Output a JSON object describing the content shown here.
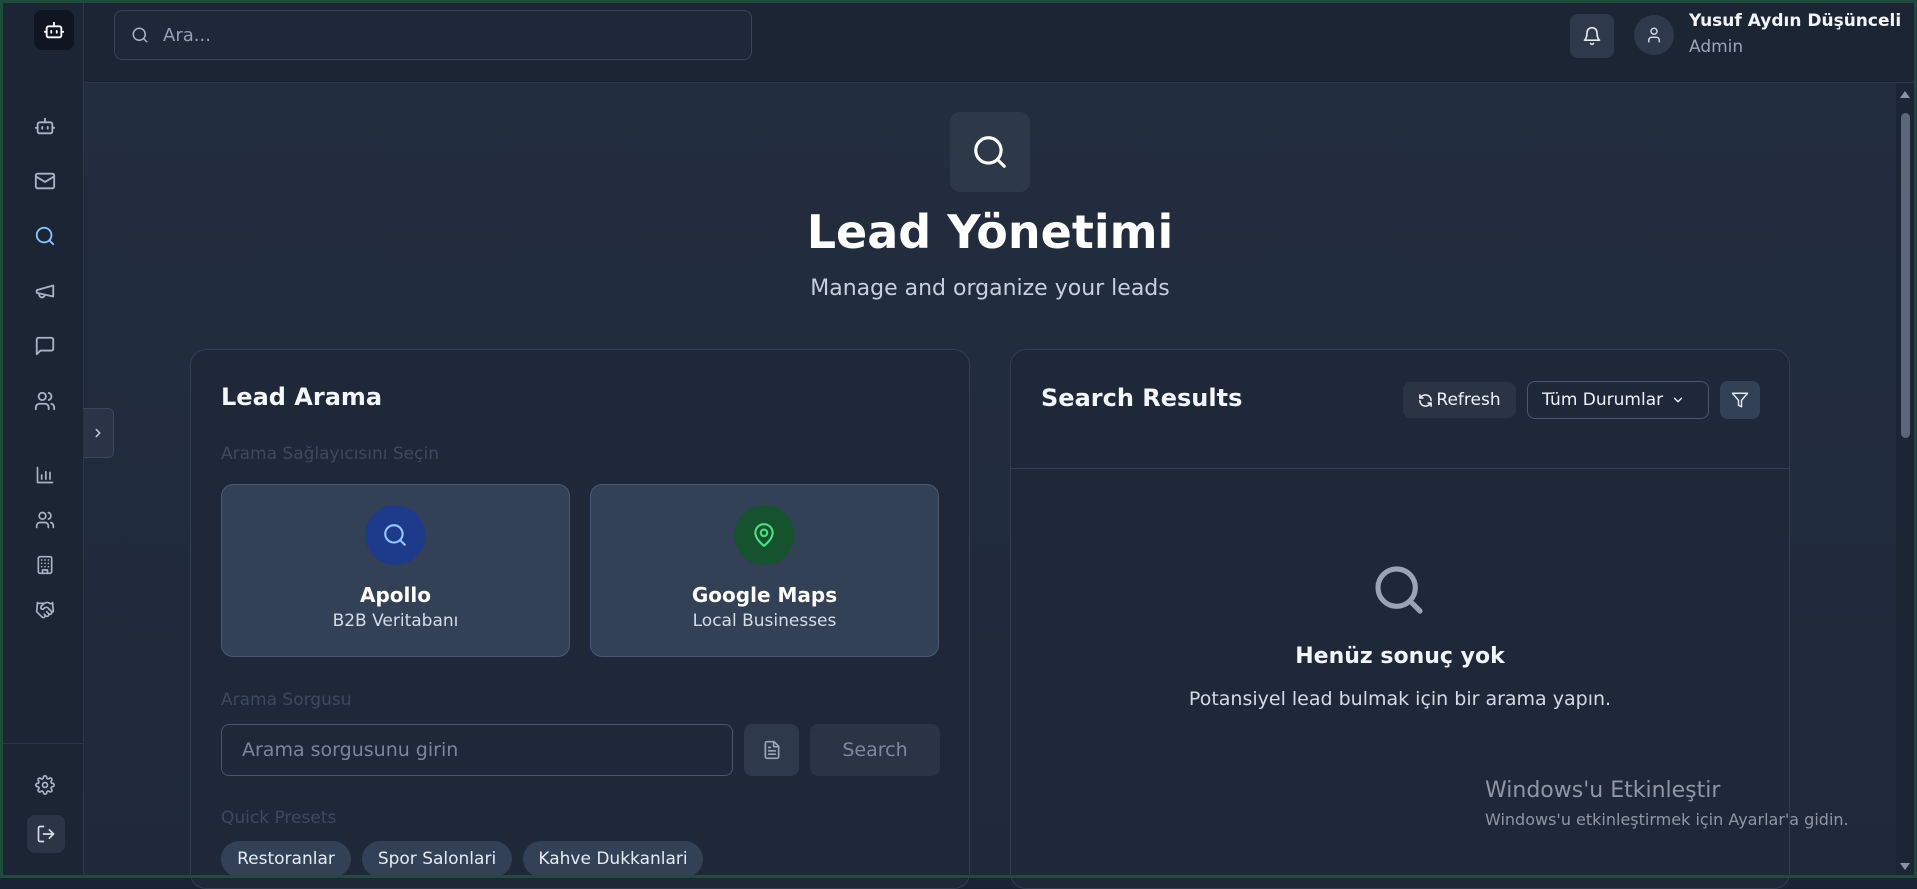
{
  "topbar": {
    "search_placeholder": "Ara...",
    "user_name": "Yusuf Aydın Düşünceli",
    "user_role": "Admin"
  },
  "sidebar": {
    "items": [
      {
        "icon": "bot-icon"
      },
      {
        "icon": "mail-icon"
      },
      {
        "icon": "search-icon",
        "active": true
      },
      {
        "icon": "megaphone-icon"
      },
      {
        "icon": "message-icon"
      },
      {
        "icon": "users-icon"
      },
      {
        "icon": "bar-chart-icon"
      },
      {
        "icon": "users-icon"
      },
      {
        "icon": "building-icon"
      },
      {
        "icon": "handshake-icon"
      }
    ],
    "bottom": [
      {
        "icon": "gear-icon"
      },
      {
        "icon": "logout-icon"
      }
    ]
  },
  "header": {
    "title": "Lead Yönetimi",
    "subtitle": "Manage and organize your leads"
  },
  "lead_search": {
    "title": "Lead Arama",
    "provider_label": "Arama Sağlayıcısını Seçin",
    "providers": [
      {
        "name": "Apollo",
        "desc": "B2B Veritabanı",
        "color": "#1e3a8a",
        "icon": "search-icon"
      },
      {
        "name": "Google Maps",
        "desc": "Local Businesses",
        "color": "#14532d",
        "icon": "map-pin-icon"
      }
    ],
    "query_label": "Arama Sorgusu",
    "query_placeholder": "Arama sorgusunu girin",
    "search_button": "Search",
    "presets_label": "Quick Presets",
    "presets": [
      "Restoranlar",
      "Spor Salonlari",
      "Kahve Dukkanlari"
    ]
  },
  "results": {
    "title": "Search Results",
    "refresh_label": "Refresh",
    "status_filter": "Tüm Durumlar",
    "empty_title": "Henüz sonuç yok",
    "empty_desc": "Potansiyel lead bulmak için bir arama yapın."
  },
  "watermark": {
    "title": "Windows'u Etkinleştir",
    "subtitle": "Windows'u etkinleştirmek için Ayarlar'a gidin."
  },
  "colors": {
    "background": "#1b2434",
    "card": "#1e2839",
    "accent": "#8ec4ff",
    "apollo": "#1e3a8a",
    "maps": "#14532d"
  }
}
